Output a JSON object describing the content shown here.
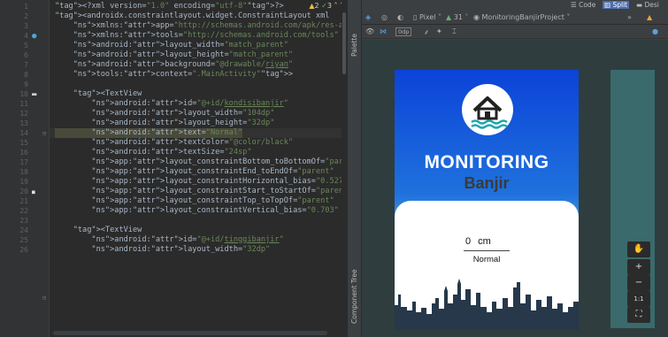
{
  "editor": {
    "warnings": {
      "warn_count": "2",
      "ok_count": "3"
    },
    "line_numbers": [
      "1",
      "2",
      "3",
      "4",
      "5",
      "6",
      "7",
      "8",
      "9",
      "10",
      "11",
      "12",
      "13",
      "14",
      "15",
      "16",
      "17",
      "18",
      "19",
      "20",
      "21",
      "22",
      "23",
      "24",
      "25",
      "26"
    ],
    "lines": [
      [
        "<?xml version=\"1.0\" encoding=\"utf-8\"?>"
      ],
      [
        "<androidx.constraintlayout.widget.ConstraintLayout xml"
      ],
      [
        "    xmlns:app=\"http://schemas.android.com/apk/res-auto"
      ],
      [
        "    xmlns:tools=\"http://schemas.android.com/tools\""
      ],
      [
        "    android:layout_width=\"match_parent\""
      ],
      [
        "    android:layout_height=\"match_parent\""
      ],
      [
        "    android:background=\"@drawable/",
        "riyan",
        "\""
      ],
      [
        "    tools:context=\".MainActivity\">"
      ],
      [
        ""
      ],
      [
        "    <TextView"
      ],
      [
        "        android:id=\"@+id/",
        "kondisibanjir",
        "\""
      ],
      [
        "        android:layout_width=\"104dp\""
      ],
      [
        "        android:layout_height=\"32dp\""
      ],
      [
        "        android:text=\"Normal\""
      ],
      [
        "        android:textColor=\"@color/black\""
      ],
      [
        "        android:textSize=\"24sp\""
      ],
      [
        "        app:layout_constraintBottom_toBottomOf=\"parent"
      ],
      [
        "        app:layout_constraintEnd_toEndOf=\"parent\""
      ],
      [
        "        app:layout_constraintHorizontal_bias=\"0.527\""
      ],
      [
        "        app:layout_constraintStart_toStartOf=\"parent\""
      ],
      [
        "        app:layout_constraintTop_toTopOf=\"parent\""
      ],
      [
        "        app:layout_constraintVertical_bias=\"0.703\" />"
      ],
      [
        ""
      ],
      [
        "    <TextView"
      ],
      [
        "        android:id=\"@+id/",
        "tinggibanjir",
        "\""
      ],
      [
        "        android:layout_width=\"32dp\""
      ]
    ]
  },
  "palette_strip": {
    "palette_label": "Palette",
    "component_tree_label": "Component Tree"
  },
  "design": {
    "modes": {
      "code": "Code",
      "split": "Split",
      "design": "Desi"
    },
    "toolbar": {
      "device": "Pixel",
      "api": "31",
      "project": "MonitoringBanjirProject",
      "dp_label": "0dp"
    },
    "preview": {
      "title": "MONITORING",
      "subtitle": "Banjir",
      "reading_value": "0",
      "reading_unit": "cm",
      "status": "Normal"
    },
    "zoom_tools": {
      "zoom_in": "+",
      "zoom_out": "−",
      "ratio": "1:1"
    }
  },
  "colors": {
    "gradient_top": "#0c43d8",
    "gradient_mid": "#1f72dd",
    "skyline": "#26384a",
    "logo_water": "#1aa6b0"
  }
}
